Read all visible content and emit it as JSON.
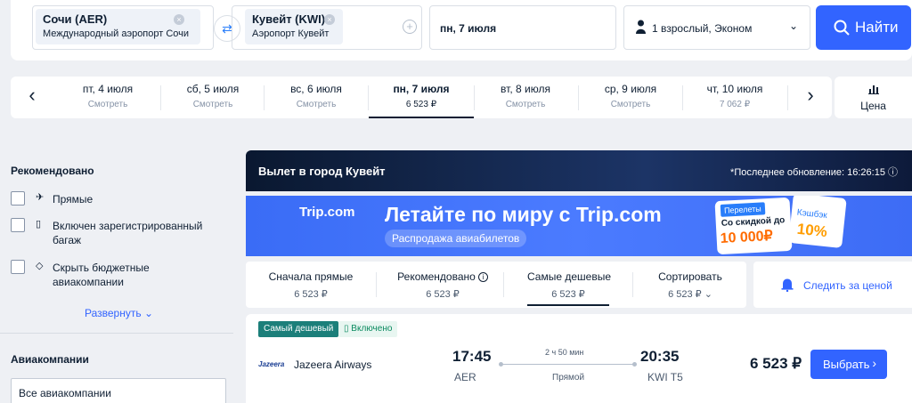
{
  "search": {
    "from_code": "Сочи (AER)",
    "from_name": "Международный аэропорт Сочи",
    "to_code": "Кувейт (KWI)",
    "to_name": "Аэропорт Кувейт",
    "date": "пн, 7 июля",
    "passengers": "1 взрослый, Эконом",
    "search_label": "Найти"
  },
  "dates": [
    {
      "day": "пт, 4 июля",
      "price": "Смотреть"
    },
    {
      "day": "сб, 5 июля",
      "price": "Смотреть"
    },
    {
      "day": "вс, 6 июля",
      "price": "Смотреть"
    },
    {
      "day": "пн, 7 июля",
      "price": "6 523 ₽",
      "selected": true
    },
    {
      "day": "вт, 8 июля",
      "price": "Смотреть"
    },
    {
      "day": "ср, 9 июля",
      "price": "Смотреть"
    },
    {
      "day": "чт, 10 июля",
      "price": "7 062 ₽"
    }
  ],
  "price_chart_label": "Цена",
  "sidebar": {
    "recommended_title": "Рекомендовано",
    "filters": [
      {
        "label": "Прямые",
        "icon": "direct-flight-icon"
      },
      {
        "label": "Включен зарегистрированный багаж",
        "icon": "luggage-icon"
      },
      {
        "label": "Скрыть бюджетные авиакомпании",
        "icon": "tag-icon"
      }
    ],
    "expand_label": "Развернуть",
    "airlines_title": "Авиакомпании",
    "airlines_select": "Все авиакомпании"
  },
  "header": {
    "title": "Вылет в город Кувейт",
    "updated": "*Последнее обновление: 16:26:15"
  },
  "banner": {
    "brand": "Trip.com",
    "headline": "Летайте по миру с Trip.com",
    "subline": "Распродажа авиабилетов",
    "card_tag": "Перелеты",
    "card_line": "Со скидкой до",
    "card_amount": "10 000₽",
    "cashback_label": "Кэшбэк",
    "cashback_pct": "10%"
  },
  "sort": [
    {
      "name": "Сначала прямые",
      "value": "6 523 ₽"
    },
    {
      "name": "Рекомендовано",
      "value": "6 523 ₽"
    },
    {
      "name": "Самые дешевые",
      "value": "6 523 ₽"
    },
    {
      "name": "Сортировать",
      "value": "6 523 ₽"
    }
  ],
  "track_label": "Следить за ценой",
  "flight": {
    "badge_cheapest": "Самый дешевый",
    "badge_included": "Включено",
    "logo": "Jazeera",
    "airline": "Jazeera Airways",
    "dep_time": "17:45",
    "dep_airport": "AER",
    "duration": "2 ч 50 мин",
    "stops": "Прямой",
    "arr_time": "20:35",
    "arr_airport": "KWI T5",
    "price": "6 523 ₽",
    "select_label": "Выбрать"
  },
  "colors": {
    "accent": "#3264ff",
    "header_dark": "#0a1830",
    "badge_green": "#1c7f7a"
  }
}
